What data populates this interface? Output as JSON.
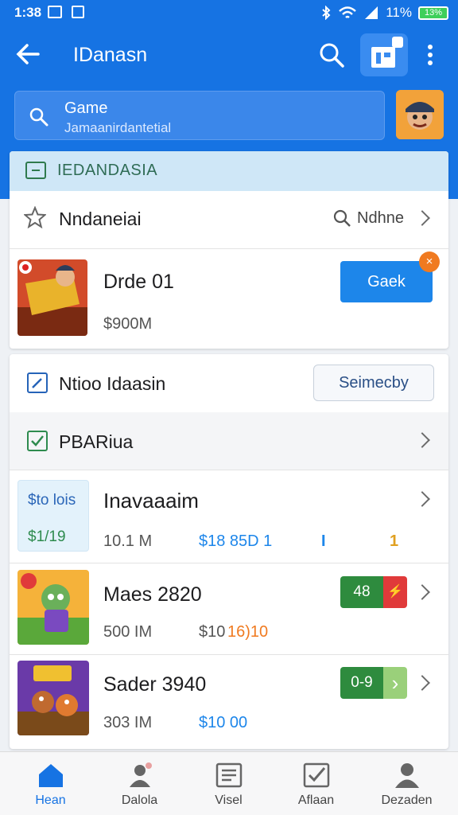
{
  "status_bar": {
    "time": "1:38",
    "battery": "11%",
    "battery_text": "13%"
  },
  "header": {
    "title": "IDanasn"
  },
  "search": {
    "line1": "Game",
    "line2": "Jamaanirdantetial"
  },
  "banner": {
    "text": "IEDANDASIA"
  },
  "favorites": {
    "label": "Nndaneiai",
    "right_label": "Ndhne"
  },
  "featured": {
    "name": "Drde 01",
    "price": "$900M",
    "button": "Gaek",
    "badge": "×"
  },
  "notice": {
    "label": "Ntioo Idaasin",
    "button": "Seimecby"
  },
  "section": {
    "label": "PBARiua"
  },
  "items": [
    {
      "thumb_l1": "$to lois",
      "thumb_l2": "$1/19",
      "name": "Inavaaaim",
      "size": "10.1 M",
      "price": "$18 85D 1",
      "extra1": "I",
      "extra2": "1"
    },
    {
      "name": "Maes 2820",
      "size": "500 IM",
      "price": "$10",
      "price_hi": "16)10",
      "pill": "48",
      "pill_icon": "⚡"
    },
    {
      "name": "Sader 3940",
      "size": "303 IM",
      "price": "$10 00",
      "pill": "0-9",
      "pill_icon": "›"
    }
  ],
  "nav": [
    {
      "label": "Hean",
      "icon": "home-icon"
    },
    {
      "label": "Dalola",
      "icon": "people-icon"
    },
    {
      "label": "Visel",
      "icon": "list-icon"
    },
    {
      "label": "Aflaan",
      "icon": "checkbox-icon"
    },
    {
      "label": "Dezaden",
      "icon": "person-icon"
    }
  ],
  "colors": {
    "primary": "#1673e3",
    "accent": "#1d86ea",
    "orange": "#f07a20",
    "green": "#2e8b4e",
    "red": "#e03a3a"
  }
}
